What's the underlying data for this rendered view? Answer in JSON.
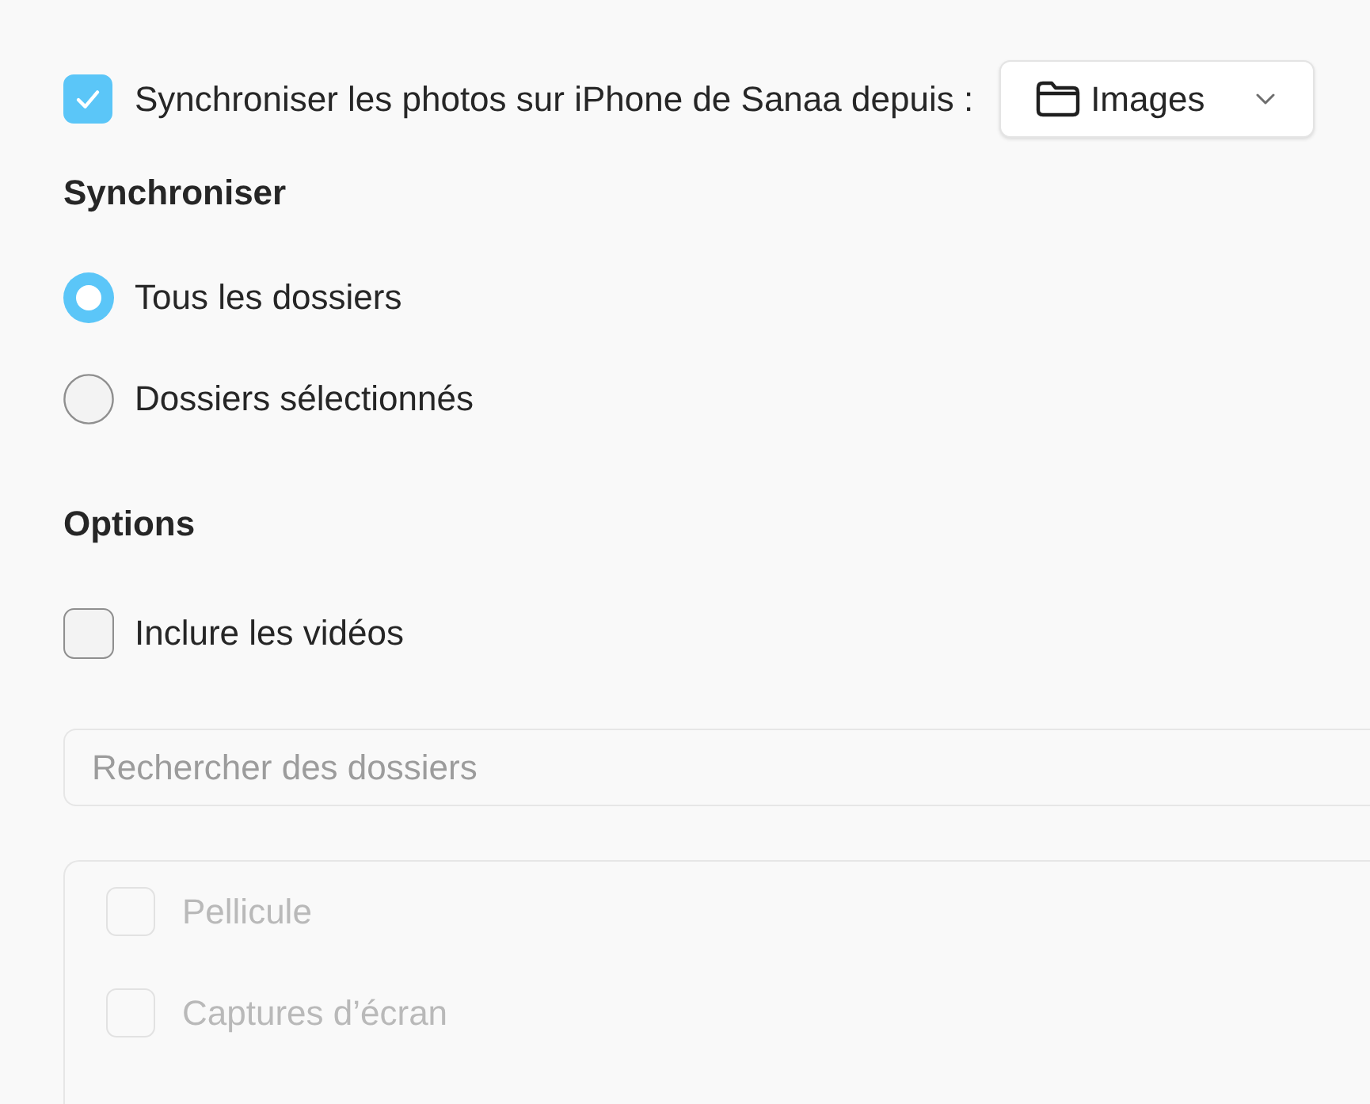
{
  "sync_photos": {
    "label": "Synchroniser les photos sur iPhone de Sanaa depuis :",
    "checked": true,
    "source": {
      "value": "Images"
    }
  },
  "sync_section": {
    "heading": "Synchroniser",
    "options": [
      {
        "label": "Tous les dossiers",
        "selected": true
      },
      {
        "label": "Dossiers sélectionnés",
        "selected": false
      }
    ]
  },
  "options_section": {
    "heading": "Options",
    "items": [
      {
        "label": "Inclure les vidéos",
        "checked": false
      }
    ]
  },
  "folder_search": {
    "placeholder": "Rechercher des dossiers"
  },
  "folders": [
    {
      "label": "Pellicule",
      "checked": false,
      "disabled": true
    },
    {
      "label": "Captures d’écran",
      "checked": false,
      "disabled": true
    }
  ]
}
